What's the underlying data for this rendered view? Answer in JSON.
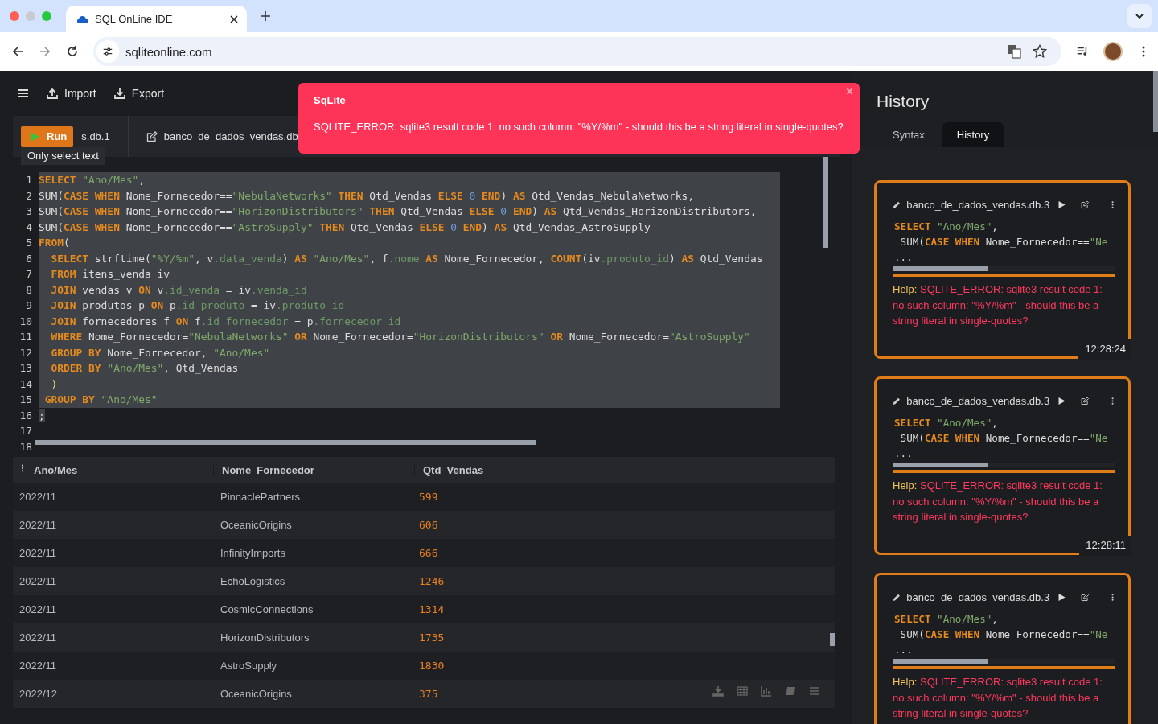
{
  "browser": {
    "tab_title": "SQL OnLine IDE",
    "url": "sqliteonline.com"
  },
  "toolbar": {
    "buttons": [
      {
        "label": "Import",
        "kind": "import"
      },
      {
        "label": "Export",
        "kind": "export"
      }
    ]
  },
  "run_button": {
    "label": "Run"
  },
  "tooltip": "Only select text",
  "editor_tabs": [
    {
      "label": "s.db.1",
      "kind": "plain"
    },
    {
      "label": "banco_de_dados_vendas.db",
      "kind": "edit"
    }
  ],
  "editor": {
    "lines": [
      {
        "number": "1",
        "selected": true,
        "tokens": [
          {
            "kind": "kw",
            "text": "SELECT "
          },
          {
            "kind": "str",
            "text": "\"Ano/Mes\""
          },
          {
            "kind": "plain",
            "text": ","
          }
        ]
      },
      {
        "number": "2",
        "selected": true,
        "tokens": [
          {
            "kind": "plain",
            "text": "SUM("
          },
          {
            "kind": "kw",
            "text": "CASE WHEN"
          },
          {
            "kind": "plain",
            "text": " Nome_Fornecedor=="
          },
          {
            "kind": "str",
            "text": "\"NebulaNetworks\""
          },
          {
            "kind": "kw",
            "text": " THEN"
          },
          {
            "kind": "plain",
            "text": " Qtd_Vendas "
          },
          {
            "kind": "kw",
            "text": "ELSE "
          },
          {
            "kind": "num",
            "text": "0"
          },
          {
            "kind": "kw",
            "text": " END"
          },
          {
            "kind": "plain",
            "text": ") "
          },
          {
            "kind": "kw",
            "text": "AS"
          },
          {
            "kind": "plain",
            "text": " Qtd_Vendas_NebulaNetworks,"
          }
        ]
      },
      {
        "number": "3",
        "selected": true,
        "tokens": [
          {
            "kind": "plain",
            "text": "SUM("
          },
          {
            "kind": "kw",
            "text": "CASE WHEN"
          },
          {
            "kind": "plain",
            "text": " Nome_Fornecedor=="
          },
          {
            "kind": "str",
            "text": "\"HorizonDistributors\""
          },
          {
            "kind": "kw",
            "text": " THEN"
          },
          {
            "kind": "plain",
            "text": " Qtd_Vendas "
          },
          {
            "kind": "kw",
            "text": "ELSE "
          },
          {
            "kind": "num",
            "text": "0"
          },
          {
            "kind": "kw",
            "text": " END"
          },
          {
            "kind": "plain",
            "text": ") "
          },
          {
            "kind": "kw",
            "text": "AS"
          },
          {
            "kind": "plain",
            "text": " Qtd_Vendas_HorizonDistributors,"
          }
        ]
      },
      {
        "number": "4",
        "selected": true,
        "tokens": [
          {
            "kind": "plain",
            "text": "SUM("
          },
          {
            "kind": "kw",
            "text": "CASE WHEN"
          },
          {
            "kind": "plain",
            "text": " Nome_Fornecedor=="
          },
          {
            "kind": "str",
            "text": "\"AstroSupply\""
          },
          {
            "kind": "kw",
            "text": " THEN"
          },
          {
            "kind": "plain",
            "text": " Qtd_Vendas "
          },
          {
            "kind": "kw",
            "text": "ELSE "
          },
          {
            "kind": "num",
            "text": "0"
          },
          {
            "kind": "kw",
            "text": " END"
          },
          {
            "kind": "plain",
            "text": ") "
          },
          {
            "kind": "kw",
            "text": "AS"
          },
          {
            "kind": "plain",
            "text": " Qtd_Vendas_AstroSupply"
          }
        ]
      },
      {
        "number": "5",
        "selected": true,
        "tokens": [
          {
            "kind": "kw",
            "text": "FROM"
          },
          {
            "kind": "plain",
            "text": "("
          }
        ]
      },
      {
        "number": "6",
        "selected": true,
        "tokens": [
          {
            "kind": "kw",
            "text": "  SELECT"
          },
          {
            "kind": "plain",
            "text": " strftime("
          },
          {
            "kind": "str",
            "text": "\"%Y/%m\""
          },
          {
            "kind": "plain",
            "text": ", v"
          },
          {
            "kind": "prop",
            "text": ".data_venda"
          },
          {
            "kind": "plain",
            "text": ") "
          },
          {
            "kind": "kw",
            "text": "AS "
          },
          {
            "kind": "str",
            "text": "\"Ano/Mes\""
          },
          {
            "kind": "plain",
            "text": ", f"
          },
          {
            "kind": "prop",
            "text": ".nome"
          },
          {
            "kind": "kw",
            "text": " AS"
          },
          {
            "kind": "plain",
            "text": " Nome_Fornecedor, "
          },
          {
            "kind": "kw",
            "text": "COUNT"
          },
          {
            "kind": "plain",
            "text": "(iv"
          },
          {
            "kind": "prop",
            "text": ".produto_id"
          },
          {
            "kind": "plain",
            "text": ") "
          },
          {
            "kind": "kw",
            "text": "AS"
          },
          {
            "kind": "plain",
            "text": " Qtd_Vendas"
          }
        ]
      },
      {
        "number": "7",
        "selected": true,
        "tokens": [
          {
            "kind": "kw",
            "text": "  FROM"
          },
          {
            "kind": "plain",
            "text": " itens_venda iv"
          }
        ]
      },
      {
        "number": "8",
        "selected": true,
        "tokens": [
          {
            "kind": "kw",
            "text": "  JOIN"
          },
          {
            "kind": "plain",
            "text": " vendas v "
          },
          {
            "kind": "kw",
            "text": "ON"
          },
          {
            "kind": "plain",
            "text": " v"
          },
          {
            "kind": "prop",
            "text": ".id_venda"
          },
          {
            "kind": "plain",
            "text": " = iv"
          },
          {
            "kind": "prop",
            "text": ".venda_id"
          }
        ]
      },
      {
        "number": "9",
        "selected": true,
        "tokens": [
          {
            "kind": "kw",
            "text": "  JOIN"
          },
          {
            "kind": "plain",
            "text": " produtos p "
          },
          {
            "kind": "kw",
            "text": "ON"
          },
          {
            "kind": "plain",
            "text": " p"
          },
          {
            "kind": "prop",
            "text": ".id_produto"
          },
          {
            "kind": "plain",
            "text": " = iv"
          },
          {
            "kind": "prop",
            "text": ".produto_id"
          }
        ]
      },
      {
        "number": "10",
        "selected": true,
        "tokens": [
          {
            "kind": "kw",
            "text": "  JOIN"
          },
          {
            "kind": "plain",
            "text": " fornecedores f "
          },
          {
            "kind": "kw",
            "text": "ON"
          },
          {
            "kind": "plain",
            "text": " f"
          },
          {
            "kind": "prop",
            "text": ".id_fornecedor"
          },
          {
            "kind": "plain",
            "text": " = p"
          },
          {
            "kind": "prop",
            "text": ".fornecedor_id"
          }
        ]
      },
      {
        "number": "11",
        "selected": true,
        "tokens": [
          {
            "kind": "kw",
            "text": "  WHERE"
          },
          {
            "kind": "plain",
            "text": " Nome_Fornecedor="
          },
          {
            "kind": "str",
            "text": "\"NebulaNetworks\""
          },
          {
            "kind": "kw",
            "text": " OR"
          },
          {
            "kind": "plain",
            "text": " Nome_Fornecedor="
          },
          {
            "kind": "str",
            "text": "\"HorizonDistributors\""
          },
          {
            "kind": "kw",
            "text": " OR"
          },
          {
            "kind": "plain",
            "text": " Nome_Fornecedor="
          },
          {
            "kind": "str",
            "text": "\"AstroSupply\""
          }
        ]
      },
      {
        "number": "12",
        "selected": true,
        "tokens": [
          {
            "kind": "kw",
            "text": "  GROUP BY"
          },
          {
            "kind": "plain",
            "text": " Nome_Fornecedor, "
          },
          {
            "kind": "str",
            "text": "\"Ano/Mes\""
          }
        ]
      },
      {
        "number": "13",
        "selected": true,
        "tokens": [
          {
            "kind": "kw",
            "text": "  ORDER BY "
          },
          {
            "kind": "str",
            "text": "\"Ano/Mes\""
          },
          {
            "kind": "plain",
            "text": ", Qtd_Vendas"
          }
        ]
      },
      {
        "number": "14",
        "selected": true,
        "tokens": [
          {
            "kind": "paren",
            "text": "  )"
          }
        ]
      },
      {
        "number": "15",
        "selected": true,
        "tokens": [
          {
            "kind": "kw",
            "text": " GROUP BY "
          },
          {
            "kind": "str",
            "text": "\"Ano/Mes\""
          }
        ]
      },
      {
        "number": "16",
        "selected": false,
        "tokens": [
          {
            "kind": "sel",
            "text": ";"
          }
        ]
      },
      {
        "number": "17",
        "selected": false
      },
      {
        "number": "18",
        "selected": false
      }
    ]
  },
  "toast": {
    "title": "SqLite",
    "message": "SQLITE_ERROR: sqlite3 result code 1: no such column: \"%Y/%m\" - should this be a string literal in single-quotes?"
  },
  "results": {
    "columns": [
      "Ano/Mes",
      "Nome_Fornecedor",
      "Qtd_Vendas"
    ],
    "rows": [
      [
        "2022/11",
        "PinnaclePartners",
        "599"
      ],
      [
        "2022/11",
        "OceanicOrigins",
        "606"
      ],
      [
        "2022/11",
        "InfinityImports",
        "666"
      ],
      [
        "2022/11",
        "EchoLogistics",
        "1246"
      ],
      [
        "2022/11",
        "CosmicConnections",
        "1314"
      ],
      [
        "2022/11",
        "HorizonDistributors",
        "1735"
      ],
      [
        "2022/11",
        "AstroSupply",
        "1830"
      ],
      [
        "2022/12",
        "OceanicOrigins",
        "375"
      ]
    ]
  },
  "history": {
    "title": "History",
    "tabs": [
      {
        "label": "Syntax",
        "selected": false
      },
      {
        "label": "History",
        "selected": true
      }
    ],
    "entries": [
      {
        "file": "banco_de_dados_vendas.db.3",
        "code": [
          [
            {
              "kind": "kw",
              "text": "SELECT "
            },
            {
              "kind": "str",
              "text": "\"Ano/Mes\""
            },
            {
              "kind": "plain",
              "text": ","
            }
          ],
          [
            {
              "kind": "plain",
              "text": " SUM("
            },
            {
              "kind": "kw",
              "text": "CASE WHEN"
            },
            {
              "kind": "plain",
              "text": " Nome_Fornecedor=="
            },
            {
              "kind": "str",
              "text": "\"Ne"
            }
          ]
        ],
        "ellipsis": "...",
        "help_label": "Help:",
        "message": "SQLITE_ERROR: sqlite3 result code 1: no such column: \"%Y/%m\" - should this be a string literal in single-quotes?",
        "time": "12:28:24"
      },
      {
        "file": "banco_de_dados_vendas.db.3",
        "code": [
          [
            {
              "kind": "kw",
              "text": "SELECT "
            },
            {
              "kind": "str",
              "text": "\"Ano/Mes\""
            },
            {
              "kind": "plain",
              "text": ","
            }
          ],
          [
            {
              "kind": "plain",
              "text": " SUM("
            },
            {
              "kind": "kw",
              "text": "CASE WHEN"
            },
            {
              "kind": "plain",
              "text": " Nome_Fornecedor=="
            },
            {
              "kind": "str",
              "text": "\"Ne"
            }
          ]
        ],
        "ellipsis": "...",
        "help_label": "Help:",
        "message": "SQLITE_ERROR: sqlite3 result code 1: no such column: \"%Y/%m\" - should this be a string literal in single-quotes?",
        "time": "12:28:11"
      },
      {
        "file": "banco_de_dados_vendas.db.3",
        "code": [
          [
            {
              "kind": "kw",
              "text": "SELECT "
            },
            {
              "kind": "str",
              "text": "\"Ano/Mes\""
            },
            {
              "kind": "plain",
              "text": ","
            }
          ],
          [
            {
              "kind": "plain",
              "text": " SUM("
            },
            {
              "kind": "kw",
              "text": "CASE WHEN"
            },
            {
              "kind": "plain",
              "text": " Nome_Fornecedor=="
            },
            {
              "kind": "str",
              "text": "\"Ne"
            }
          ]
        ],
        "ellipsis": "...",
        "help_label": "Help:",
        "message": "SQLITE_ERROR: sqlite3 result code 1: no such column: \"%Y/%m\" - should this be a string literal in single-quotes?"
      }
    ]
  }
}
